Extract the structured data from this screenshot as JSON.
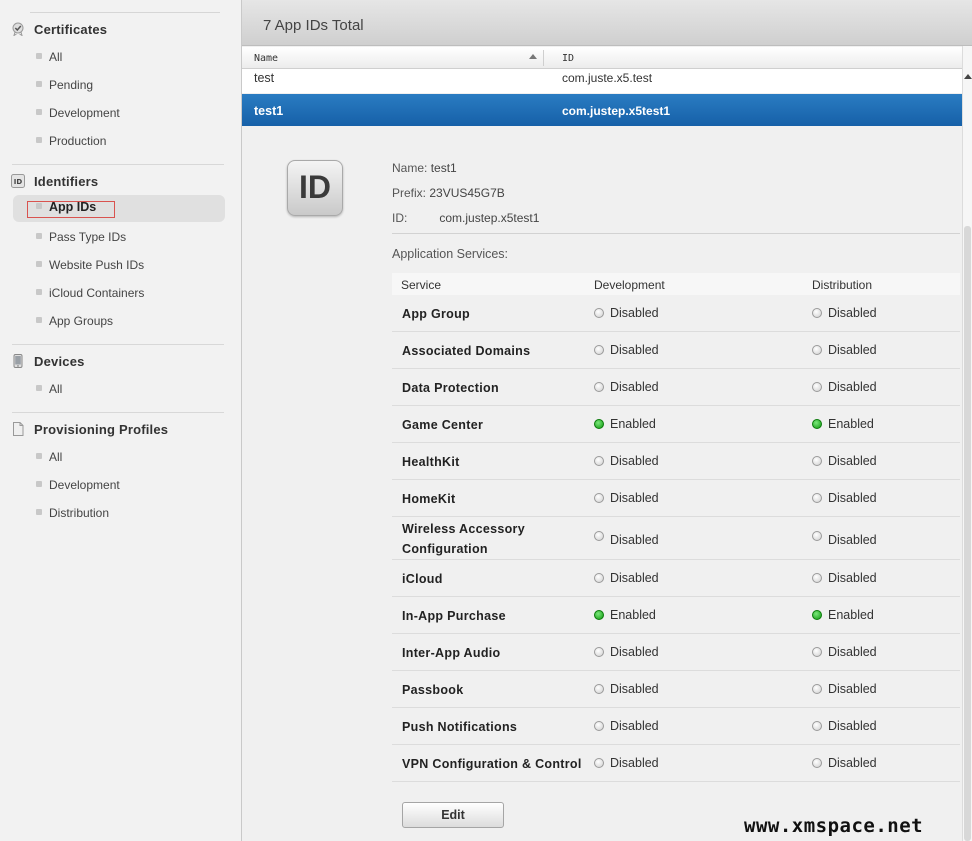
{
  "sidebar": {
    "certificates": {
      "title": "Certificates",
      "items": [
        "All",
        "Pending",
        "Development",
        "Production"
      ]
    },
    "identifiers": {
      "title": "Identifiers",
      "items": [
        "App IDs",
        "Pass Type IDs",
        "Website Push IDs",
        "iCloud Containers",
        "App Groups"
      ],
      "active": "App IDs"
    },
    "devices": {
      "title": "Devices",
      "items": [
        "All"
      ]
    },
    "profiles": {
      "title": "Provisioning Profiles",
      "items": [
        "All",
        "Development",
        "Distribution"
      ]
    }
  },
  "header": {
    "title": "7 App IDs Total"
  },
  "table": {
    "columns": [
      "Name",
      "ID"
    ],
    "rows": [
      {
        "name": "test",
        "id": "com.juste.x5.test",
        "selected": false
      },
      {
        "name": "test1",
        "id": "com.justep.x5test1",
        "selected": true
      }
    ]
  },
  "detail": {
    "icon_text": "ID",
    "name_label": "Name:",
    "name_value": "test1",
    "prefix_label": "Prefix:",
    "prefix_value": "23VUS45G7B",
    "id_label": "ID:",
    "id_value": "com.justep.x5test1",
    "services_title": "Application Services:",
    "service_columns": [
      "Service",
      "Development",
      "Distribution"
    ],
    "services": [
      {
        "name": "App Group",
        "development": "Disabled",
        "distribution": "Disabled"
      },
      {
        "name": "Associated Domains",
        "development": "Disabled",
        "distribution": "Disabled"
      },
      {
        "name": "Data Protection",
        "development": "Disabled",
        "distribution": "Disabled"
      },
      {
        "name": "Game Center",
        "development": "Enabled",
        "distribution": "Enabled"
      },
      {
        "name": "HealthKit",
        "development": "Disabled",
        "distribution": "Disabled"
      },
      {
        "name": "HomeKit",
        "development": "Disabled",
        "distribution": "Disabled"
      },
      {
        "name": "Wireless Accessory Configuration",
        "development": "Disabled",
        "distribution": "Disabled"
      },
      {
        "name": "iCloud",
        "development": "Disabled",
        "distribution": "Disabled"
      },
      {
        "name": "In-App Purchase",
        "development": "Enabled",
        "distribution": "Enabled"
      },
      {
        "name": "Inter-App Audio",
        "development": "Disabled",
        "distribution": "Disabled"
      },
      {
        "name": "Passbook",
        "development": "Disabled",
        "distribution": "Disabled"
      },
      {
        "name": "Push Notifications",
        "development": "Disabled",
        "distribution": "Disabled"
      },
      {
        "name": "VPN Configuration & Control",
        "development": "Disabled",
        "distribution": "Disabled"
      }
    ],
    "edit_label": "Edit"
  },
  "watermark": "www.xmspace.net",
  "colors": {
    "selected_row": "#1d6db4",
    "enabled": "#1aa01a",
    "disabled": "#cfcfcf",
    "active_outline": "#d9534f"
  }
}
